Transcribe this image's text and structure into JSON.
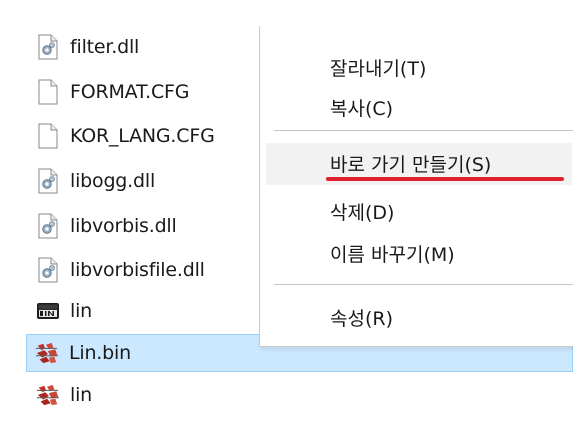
{
  "files": [
    {
      "name": "filter.dll",
      "icon": "dll-icon"
    },
    {
      "name": "FORMAT.CFG",
      "icon": "blank-file-icon"
    },
    {
      "name": "KOR_LANG.CFG",
      "icon": "blank-file-icon"
    },
    {
      "name": "libogg.dll",
      "icon": "dll-icon"
    },
    {
      "name": "libvorbis.dll",
      "icon": "dll-icon"
    },
    {
      "name": "libvorbisfile.dll",
      "icon": "dll-icon"
    },
    {
      "name": "lin",
      "icon": "bin-icon"
    },
    {
      "name": "Lin.bin",
      "icon": "app-icon",
      "selected": true
    },
    {
      "name": "lin",
      "icon": "app-icon"
    }
  ],
  "context_menu": {
    "cut": "잘라내기(T)",
    "copy": "복사(C)",
    "create_shortcut": "바로 가기 만들기(S)",
    "delete": "삭제(D)",
    "rename": "이름 바꾸기(M)",
    "properties": "속성(R)"
  },
  "colors": {
    "selection_bg": "#cce8ff",
    "selection_border": "#99d1ff",
    "annotation_underline": "#e0232a"
  }
}
